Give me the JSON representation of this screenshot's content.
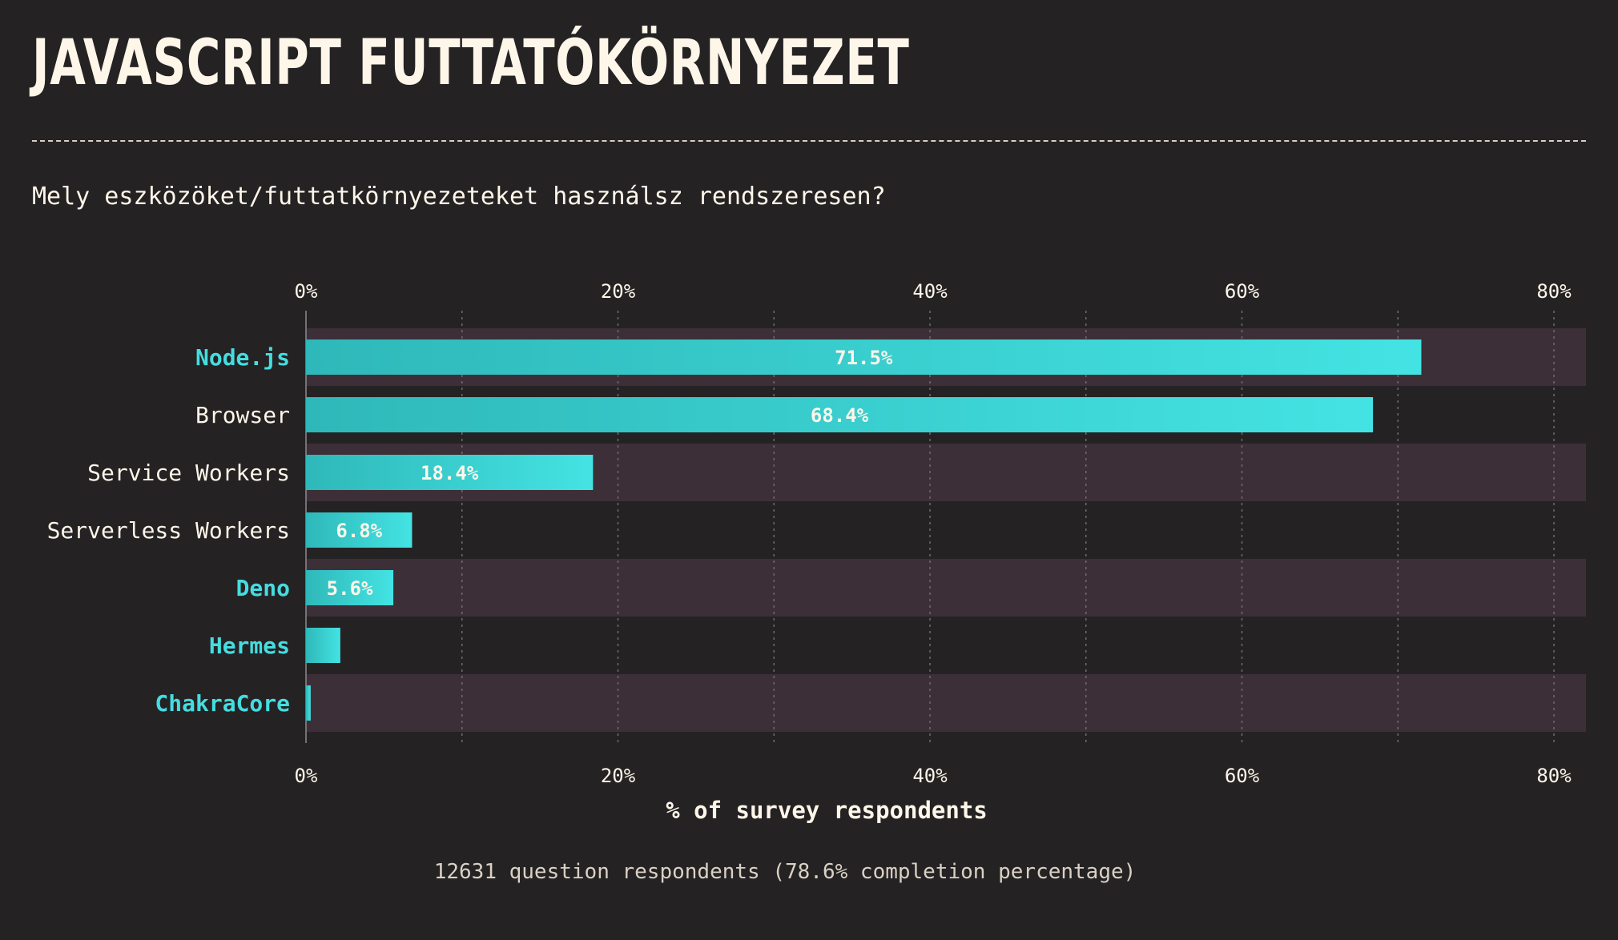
{
  "page": {
    "title": "JAVASCRIPT FUTTATÓKÖRNYEZET",
    "question": "Mely eszközöket/futtatkörnyezeteket használsz rendszeresen?",
    "footer": "12631 question respondents (78.6% completion percentage)"
  },
  "colors": {
    "background": "#252224",
    "row_band": "#3d2f38",
    "bar_start": "#2fb8b9",
    "bar_end": "#44e3e3",
    "highlight_label": "#44dde0",
    "text": "#fdf6e9"
  },
  "chart_data": {
    "type": "bar",
    "orientation": "horizontal",
    "xlabel": "% of survey respondents",
    "xlim": [
      0,
      82
    ],
    "tick_values": [
      0,
      20,
      40,
      60,
      80
    ],
    "tick_labels": [
      "0%",
      "20%",
      "40%",
      "60%",
      "80%"
    ],
    "grid": true,
    "categories": [
      "Node.js",
      "Browser",
      "Service Workers",
      "Serverless Workers",
      "Deno",
      "Hermes",
      "ChakraCore"
    ],
    "values": [
      71.5,
      68.4,
      18.4,
      6.8,
      5.6,
      2.2,
      0.3
    ],
    "value_labels": [
      "71.5%",
      "68.4%",
      "18.4%",
      "6.8%",
      "5.6%",
      "",
      ""
    ],
    "highlighted": [
      true,
      false,
      false,
      false,
      true,
      true,
      true
    ]
  }
}
